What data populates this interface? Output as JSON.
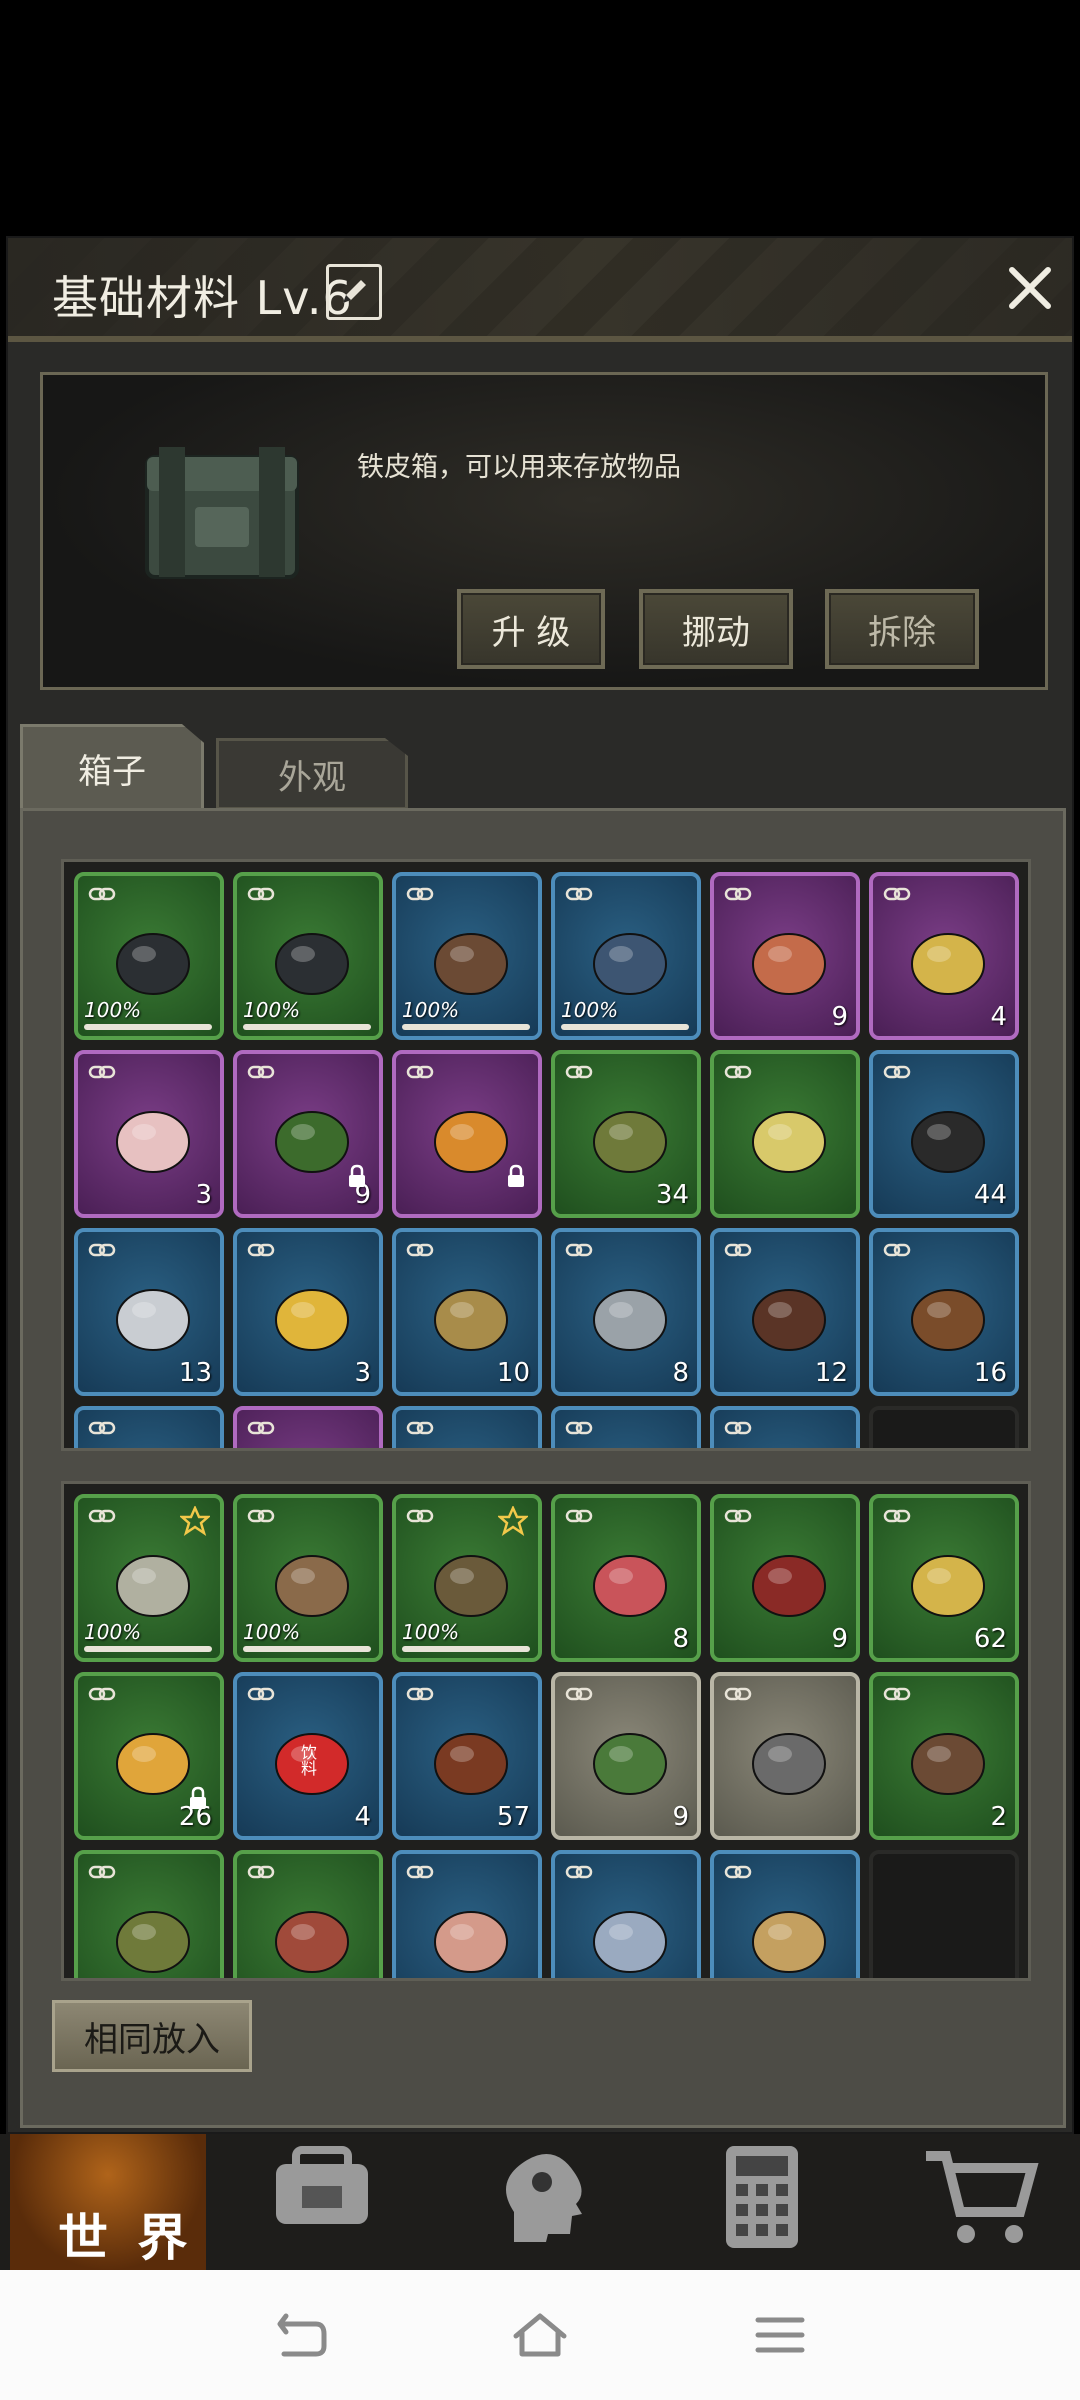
{
  "modal": {
    "title": "基础材料 Lv.6",
    "description": "铁皮箱，可以用来存放物品",
    "buttons": {
      "upgrade": "升 级",
      "move": "挪动",
      "dismantle": "拆除"
    },
    "tabs": [
      {
        "label": "箱子",
        "active": true
      },
      {
        "label": "外观",
        "active": false
      }
    ],
    "same_put_label": "相同放入"
  },
  "box_items": [
    {
      "name": "sneakers",
      "rarity": "green",
      "durability": "100%"
    },
    {
      "name": "sneakers",
      "rarity": "green",
      "durability": "100%"
    },
    {
      "name": "leather-jacket",
      "rarity": "blue",
      "durability": "100%"
    },
    {
      "name": "jeans",
      "rarity": "blue",
      "durability": "100%"
    },
    {
      "name": "potato",
      "rarity": "purple",
      "count": "9"
    },
    {
      "name": "corn",
      "rarity": "purple",
      "count": "4"
    },
    {
      "name": "mushroom",
      "rarity": "purple",
      "count": "3"
    },
    {
      "name": "pumpkin",
      "rarity": "purple",
      "count": "9",
      "locked": true
    },
    {
      "name": "stir-fry-dish",
      "rarity": "purple",
      "locked": true
    },
    {
      "name": "plant-fiber",
      "rarity": "green",
      "count": "34"
    },
    {
      "name": "seeds",
      "rarity": "green"
    },
    {
      "name": "gunpowder",
      "rarity": "blue",
      "count": "44"
    },
    {
      "name": "iron-ingot",
      "rarity": "blue",
      "count": "13"
    },
    {
      "name": "gold-ingot",
      "rarity": "blue",
      "count": "3"
    },
    {
      "name": "copper-ingot",
      "rarity": "blue",
      "count": "10"
    },
    {
      "name": "steel-beam",
      "rarity": "blue",
      "count": "8"
    },
    {
      "name": "leather-hide",
      "rarity": "blue",
      "count": "12"
    },
    {
      "name": "spices",
      "rarity": "blue",
      "count": "16"
    },
    {
      "name": "partial",
      "rarity": "blue"
    },
    {
      "name": "partial",
      "rarity": "purple"
    },
    {
      "name": "partial",
      "rarity": "blue"
    },
    {
      "name": "partial",
      "rarity": "blue"
    },
    {
      "name": "partial",
      "rarity": "blue"
    },
    {
      "name": "empty",
      "rarity": "empty"
    }
  ],
  "backpack_items": [
    {
      "name": "spear",
      "rarity": "green",
      "durability": "100%",
      "starred": true
    },
    {
      "name": "fishing-rod",
      "rarity": "green",
      "durability": "100%"
    },
    {
      "name": "bow",
      "rarity": "green",
      "durability": "100%",
      "starred": true
    },
    {
      "name": "raw-meat",
      "rarity": "green",
      "count": "8"
    },
    {
      "name": "steak",
      "rarity": "green",
      "count": "9"
    },
    {
      "name": "corn",
      "rarity": "green",
      "count": "62"
    },
    {
      "name": "stew-pot",
      "rarity": "green",
      "count": "26",
      "locked": true
    },
    {
      "name": "soda-can",
      "rarity": "blue",
      "count": "4",
      "label": "饮料"
    },
    {
      "name": "grilled-skewers",
      "rarity": "blue",
      "count": "57"
    },
    {
      "name": "herb",
      "rarity": "gray",
      "count": "9"
    },
    {
      "name": "broken-parts",
      "rarity": "gray"
    },
    {
      "name": "animal-hide",
      "rarity": "green",
      "count": "2"
    },
    {
      "name": "plant-fiber",
      "rarity": "green"
    },
    {
      "name": "worm",
      "rarity": "green"
    },
    {
      "name": "ear",
      "rarity": "blue"
    },
    {
      "name": "axe",
      "rarity": "blue"
    },
    {
      "name": "claw",
      "rarity": "blue"
    },
    {
      "name": "empty",
      "rarity": "empty"
    }
  ],
  "bottom_nav": {
    "world_label": "世 界",
    "items": [
      "world",
      "backpack-icon",
      "head-icon",
      "calculator-icon",
      "cart-icon"
    ]
  },
  "system_nav": [
    "back-icon",
    "home-icon",
    "menu-icon"
  ]
}
